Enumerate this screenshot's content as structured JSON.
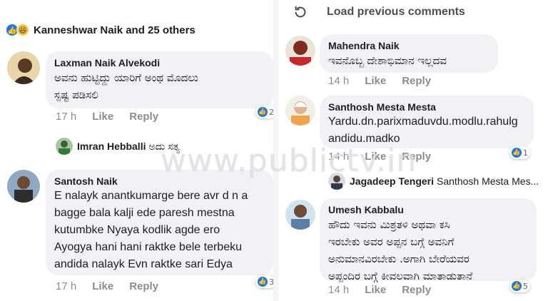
{
  "left": {
    "reactions": {
      "label": "Kanneshwar Naik and 25 others",
      "icons": [
        "like-icon",
        "haha-icon"
      ]
    },
    "comments": [
      {
        "author": "Laxman Naik Alvekodi",
        "text_line1": "ಅವನು ಹುಟ್ಟಿದ್ದು ಯಾರಿಗೆ ಅಂಥ ಮೊದಲು",
        "text_line2": "ಸ್ಪಷ್ಟ ಪಡಿಸಲಿ",
        "time": "17 h",
        "like": "Like",
        "reply": "Reply",
        "likes": "2"
      },
      {
        "author": "Santosh Naik",
        "lines": [
          "E nalayk anantkumarge bere avr d n a",
          "bagge bala kalji ede paresh mestna",
          "kutumbke Nyaya kodlik agde ero",
          "Ayogya hani hani raktke bele terbeku",
          "andida nalayk Evn raktke sari Edya"
        ],
        "time": "17 h",
        "like": "Like",
        "reply": "Reply",
        "likes": "3"
      }
    ],
    "reply_preview": {
      "author": "Imran Hebballi",
      "text": "ಅದು ಸತ್ಯ"
    }
  },
  "right": {
    "load_previous": "Load previous comments",
    "comments": [
      {
        "author": "Mahendra Naik",
        "text": "ಇವನೊಬ್ಬ ದೇಶಾಭಿಮಾನ ಇಲ್ಲದವ",
        "time": "14 h",
        "like": "Like",
        "reply": "Reply"
      },
      {
        "author": "Santhosh Mesta Mesta",
        "line1": "Yardu.dn.parixmaduvdu.modlu.rahulg",
        "line2": "andidu.madko",
        "time": "14 h",
        "like": "Like",
        "reply": "Reply",
        "likes": "1"
      },
      {
        "author": "Umesh Kabbalu",
        "lines": [
          "ಹೌದು ಇವನು ಮಿಶ್ರತಳಿ ಅಥವಾ ಕಸಿ",
          "ಇರಬೇಕು ಅವರ ಅಪ್ಪನ ಬಗ್ಗೆ ಅವನಿಗೆ",
          "ಅನುಮಾನವಿರಬೇಕು .ಅಗಾಗಿ ಬೇರೆಯವರ",
          "ಅಪ್ಪಂದಿರ ಬಗ್ಗೆ ಕೀವಲವಾಗಿ ಮಾತಾಡುತಾನೆ"
        ],
        "time": "14 h",
        "like": "Like",
        "reply": "Reply",
        "likes": "5"
      }
    ],
    "reply_preview": {
      "author": "Jagadeep Tengeri",
      "text": "Santhosh Mesta Mes..."
    }
  },
  "watermark": "www.publictv.in",
  "colors": {
    "bubble": "#f0f2f5",
    "like_blue": "#1877f2",
    "meta_gray": "#8a8d91"
  }
}
